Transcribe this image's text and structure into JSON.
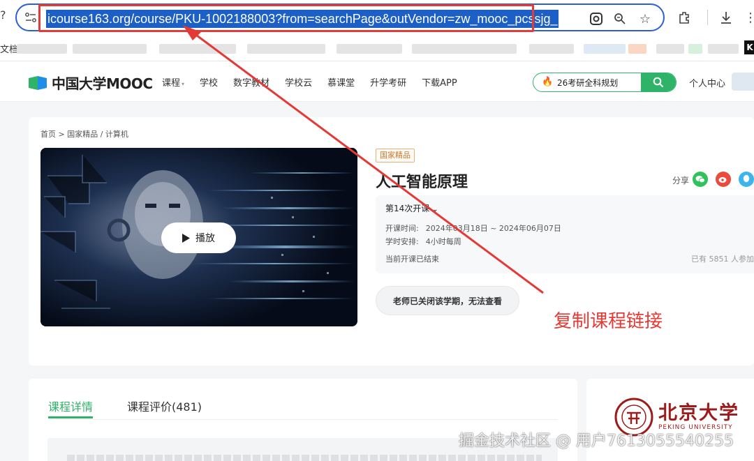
{
  "browser": {
    "url": "icourse163.org/course/PKU-1002188003?from=searchPage&outVendor=zw_mooc_pcssjg_",
    "bookmark_label": "文档",
    "bookmark_end": "K"
  },
  "header": {
    "logo_text": "中国大学MOOC",
    "nav": [
      "课程",
      "学校",
      "数字教材",
      "学校云",
      "慕课堂",
      "升学考研",
      "下载APP"
    ],
    "search_text": "26考研全科规划",
    "personal_center": "个人中心"
  },
  "course": {
    "breadcrumb": "首页  >  国家精品 / 计算机",
    "badge": "国家精品",
    "title": "人工智能原理",
    "share_label": "分享",
    "play_label": "播放",
    "term": "第14次开课",
    "schedule": [
      {
        "label": "开课时间:",
        "value": "2024年03月18日 ~ 2024年06月07日"
      },
      {
        "label": "学时安排:",
        "value": "4小时每周"
      }
    ],
    "status": "当前开课已结束",
    "enrolled": "已有 5851 人参加",
    "closed_button": "老师已关闭该学期，无法查看"
  },
  "annotation": "复制课程链接",
  "tabs": [
    {
      "label": "课程详情",
      "active": true
    },
    {
      "label": "课程评价(481)",
      "active": false
    }
  ],
  "school": {
    "name_cn": "北京大学",
    "name_en": "PEKING UNIVERSITY"
  },
  "watermark": "掘金技术社区 @ 用户7613055540255",
  "colors": {
    "brand_green": "#2fb368",
    "annotation_red": "#e53935",
    "url_highlight": "#1b5fc7"
  }
}
